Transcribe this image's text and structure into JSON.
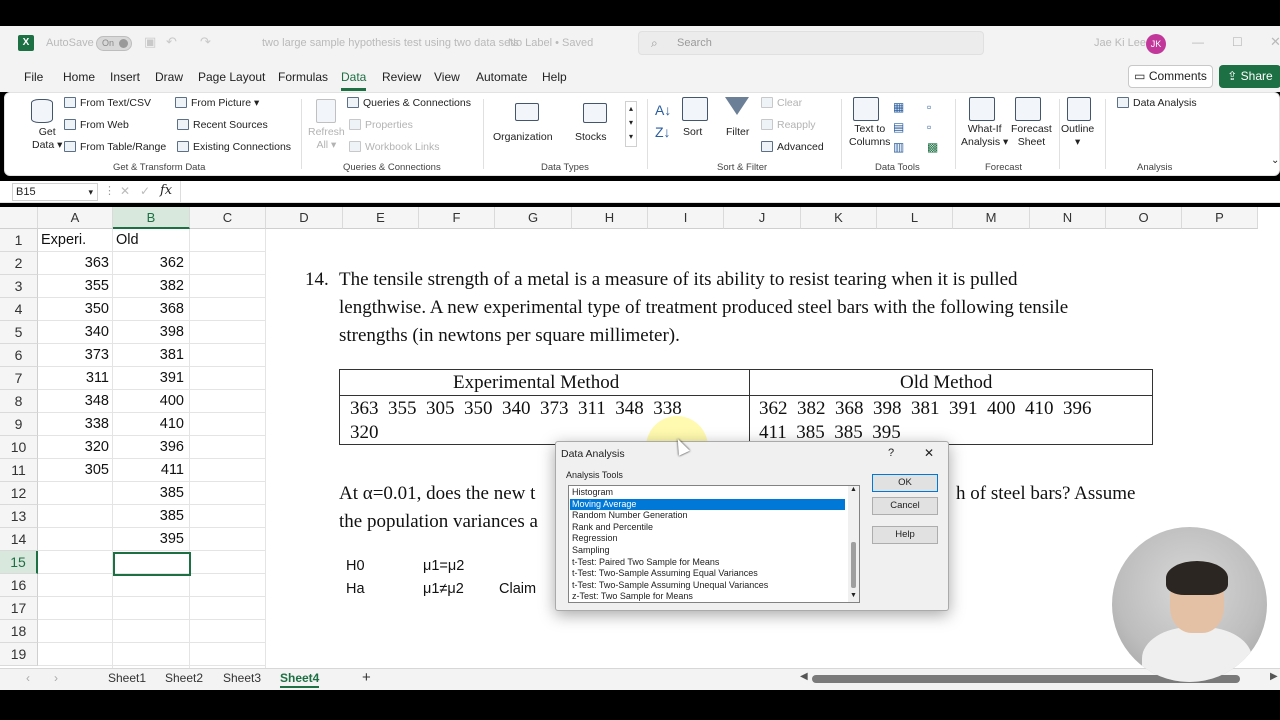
{
  "titlebar": {
    "autosave_label": "AutoSave",
    "autosave_state": "On",
    "doc_title": "two large sample hypothesis test using two data sets",
    "label_status": "No Label • Saved",
    "search_placeholder": "Search",
    "user_name": "Jae Ki Lee",
    "user_initials": "JK"
  },
  "menu": {
    "items": [
      "File",
      "Home",
      "Insert",
      "Draw",
      "Page Layout",
      "Formulas",
      "Data",
      "Review",
      "View",
      "Automate",
      "Help"
    ],
    "active": "Data",
    "comments_label": "Comments",
    "share_label": "Share"
  },
  "ribbon": {
    "get_data": "Get Data",
    "get_data_line1": "Get",
    "get_data_line2": "Data",
    "from_text_csv": "From Text/CSV",
    "from_web": "From Web",
    "from_table_range": "From Table/Range",
    "from_picture": "From Picture",
    "recent_sources": "Recent Sources",
    "existing_connections": "Existing Connections",
    "group_get_transform": "Get & Transform Data",
    "refresh_all_line1": "Refresh",
    "refresh_all_line2": "All",
    "queries_connections": "Queries & Connections",
    "properties": "Properties",
    "workbook_links": "Workbook Links",
    "group_queries": "Queries & Connections",
    "organization": "Organization",
    "stocks": "Stocks",
    "group_data_types": "Data Types",
    "sort": "Sort",
    "filter": "Filter",
    "clear": "Clear",
    "reapply": "Reapply",
    "advanced": "Advanced",
    "group_sort_filter": "Sort & Filter",
    "text_to_columns_line1": "Text to",
    "text_to_columns_line2": "Columns",
    "group_data_tools": "Data Tools",
    "what_if_line1": "What-If",
    "what_if_line2": "Analysis",
    "forecast_sheet_line1": "Forecast",
    "forecast_sheet_line2": "Sheet",
    "group_forecast": "Forecast",
    "outline": "Outline",
    "data_analysis": "Data Analysis",
    "group_analysis": "Analysis"
  },
  "formula_bar": {
    "name_box": "B15",
    "fx": "fx",
    "value": ""
  },
  "sheet": {
    "columns": [
      "A",
      "B",
      "C",
      "D",
      "E",
      "F",
      "G",
      "H",
      "I",
      "J",
      "K",
      "L",
      "M",
      "N",
      "O",
      "P"
    ],
    "selected_column": "B",
    "rows": [
      "1",
      "2",
      "3",
      "4",
      "5",
      "6",
      "7",
      "8",
      "9",
      "10",
      "11",
      "12",
      "13",
      "14",
      "15",
      "16",
      "17",
      "18",
      "19"
    ],
    "selected_row": "15",
    "col_a": [
      "Experi.",
      "363",
      "355",
      "350",
      "340",
      "373",
      "311",
      "348",
      "338",
      "320",
      "305",
      "",
      "",
      ""
    ],
    "col_b": [
      "Old",
      "362",
      "382",
      "368",
      "398",
      "381",
      "391",
      "400",
      "410",
      "396",
      "411",
      "385",
      "385",
      "395"
    ]
  },
  "problem": {
    "number": "14.",
    "line1": "The tensile strength of a metal is a measure of its ability to resist tearing when it is pulled",
    "line2": "lengthwise. A new experimental type of treatment produced steel bars with the following tensile",
    "line3": "strengths (in newtons per square millimeter).",
    "table_head_exp": "Experimental Method",
    "table_head_old": "Old Method",
    "exp_values_line1": "363  355  305  350  340  373  311  348  338",
    "exp_values_line2": "320",
    "old_values_line1": "362  382  368  398  381  391  400  410  396",
    "old_values_line2": "411  385  385  395",
    "question_start": "At α=0.01, does the new t",
    "question_end": "h of steel bars? Assume",
    "question_line2": "the population variances a"
  },
  "hypotheses": {
    "h0_label": "H0",
    "h0_expr": "μ1=μ2",
    "ha_label": "Ha",
    "ha_expr": "μ1≠μ2",
    "claim": "Claim"
  },
  "tabs": {
    "sheets": [
      "Sheet1",
      "Sheet2",
      "Sheet3",
      "Sheet4"
    ],
    "active": "Sheet4",
    "add": "+"
  },
  "dialog": {
    "title": "Data Analysis",
    "help_glyph": "?",
    "close_glyph": "✕",
    "list_label": "Analysis Tools",
    "items": [
      "Histogram",
      "Moving Average",
      "Random Number Generation",
      "Rank and Percentile",
      "Regression",
      "Sampling",
      "t-Test: Paired Two Sample for Means",
      "t-Test: Two-Sample Assuming Equal Variances",
      "t-Test: Two-Sample Assuming Unequal Variances",
      "z-Test: Two Sample for Means"
    ],
    "selected": "Moving Average",
    "ok": "OK",
    "cancel": "Cancel",
    "help": "Help"
  },
  "colors": {
    "excel_green": "#1d7044",
    "selection_blue": "#0078d7",
    "avatar_pink": "#c2379a"
  }
}
